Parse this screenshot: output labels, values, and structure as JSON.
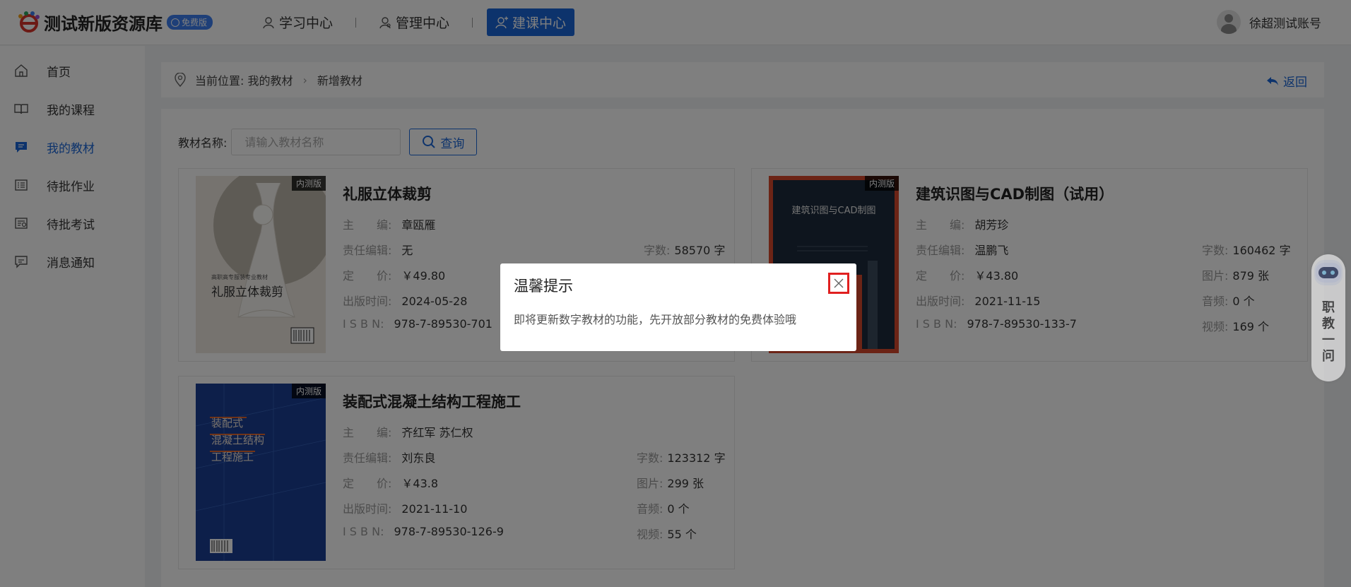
{
  "app": {
    "title": "测试新版资源库",
    "badge": "免费版"
  },
  "nav": {
    "items": [
      {
        "label": "学习中心"
      },
      {
        "label": "管理中心"
      },
      {
        "label": "建课中心"
      }
    ]
  },
  "user": {
    "name": "徐超测试账号"
  },
  "sidebar": {
    "items": [
      {
        "label": "首页"
      },
      {
        "label": "我的课程"
      },
      {
        "label": "我的教材"
      },
      {
        "label": "待批作业"
      },
      {
        "label": "待批考试"
      },
      {
        "label": "消息通知"
      }
    ]
  },
  "breadcrumb": {
    "prefix": "当前位置: 我的教材",
    "current": "新增教材",
    "back": "返回"
  },
  "search": {
    "label": "教材名称:",
    "placeholder": "请输入教材名称",
    "button": "查询"
  },
  "labels": {
    "editor": "主　　编:",
    "resp_editor": "责任编辑:",
    "price": "定　　价:",
    "pub_date": "出版时间:",
    "isbn": "I S B N:",
    "words": "字数:",
    "images": "图片:",
    "audio": "音频:",
    "video": "视频:",
    "tag": "内测版"
  },
  "books": [
    {
      "title": "礼服立体裁剪",
      "editor": "章瓯雁",
      "resp_editor": "无",
      "price": "￥49.80",
      "pub_date": "2024-05-28",
      "isbn": "978-7-89530-701",
      "words": "58570 字",
      "cover_title": "礼服立体裁剪",
      "cover_sub": "高职高专服装专业教材"
    },
    {
      "title": "建筑识图与CAD制图（试用）",
      "editor": "胡芳珍",
      "resp_editor": "温鹏飞",
      "price": "￥43.80",
      "pub_date": "2021-11-15",
      "isbn": "978-7-89530-133-7",
      "words": "160462 字",
      "images": "879 张",
      "audio": "0 个",
      "video": "169 个",
      "cover_title": "建筑识图与CAD制图"
    },
    {
      "title": "装配式混凝土结构工程施工",
      "editor": "齐红军 苏仁权",
      "resp_editor": "刘东良",
      "price": "￥43.8",
      "pub_date": "2021-11-10",
      "isbn": "978-7-89530-126-9",
      "words": "123312 字",
      "images": "299 张",
      "audio": "0 个",
      "video": "55 个",
      "cover_lines": [
        "装配式",
        "混凝土结构",
        "工程施工"
      ]
    }
  ],
  "dialog": {
    "title": "温馨提示",
    "message": "即将更新数字教材的功能，先开放部分教材的免费体验哦"
  },
  "robot": {
    "label": "职教一问"
  },
  "icons": {
    "logo": "e-logo-icon",
    "close": "close-icon",
    "search": "search-icon",
    "back": "back-arrow-icon",
    "location": "location-pin-icon"
  },
  "colors": {
    "primary": "#1a67d8",
    "highlight": "#e02020"
  }
}
